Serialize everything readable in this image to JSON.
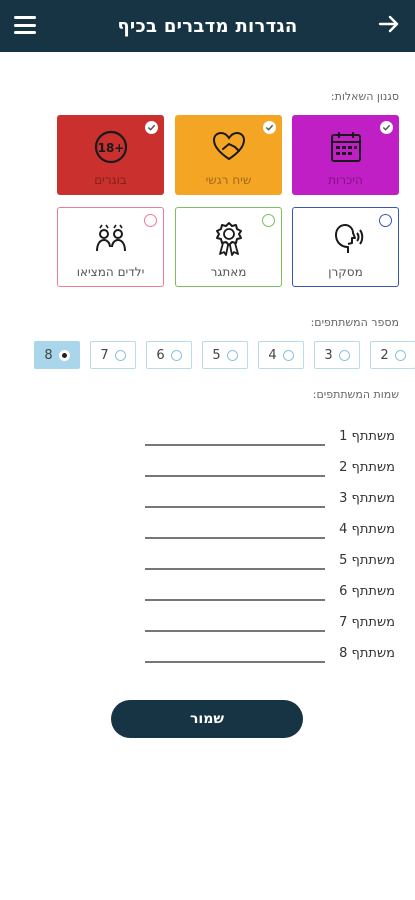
{
  "header": {
    "title": "הגדרות מדברים בכיף"
  },
  "styles_section": {
    "label": "סגנון השאלות:",
    "cards": [
      {
        "label": "היכרות",
        "selected": true,
        "color": "#c11fc6",
        "icon": "calendar-icon"
      },
      {
        "label": "שיח רגשי",
        "selected": true,
        "color": "#f5a524",
        "icon": "heart-hand-icon"
      },
      {
        "label": "בוגרים",
        "selected": true,
        "color": "#c9302e",
        "icon": "age-18-icon"
      },
      {
        "label": "מסקרן",
        "selected": false,
        "color": "#3a56b8",
        "icon": "listening-head-icon"
      },
      {
        "label": "מאתגר",
        "selected": false,
        "color": "#7dbf5c",
        "icon": "award-ribbon-icon"
      },
      {
        "label": "ילדים המציאו",
        "selected": false,
        "color": "#ee7c92",
        "icon": "kids-group-icon"
      }
    ]
  },
  "count_section": {
    "label": "מספר המשתתפים:",
    "options": [
      "2",
      "3",
      "4",
      "5",
      "6",
      "7",
      "8"
    ],
    "selected": "8"
  },
  "names_section": {
    "label": "שמות המשתתפים:",
    "participants": [
      {
        "label": "משתתף 1",
        "value": ""
      },
      {
        "label": "משתתף 2",
        "value": ""
      },
      {
        "label": "משתתף 3",
        "value": ""
      },
      {
        "label": "משתתף 4",
        "value": ""
      },
      {
        "label": "משתתף 5",
        "value": ""
      },
      {
        "label": "משתתף 6",
        "value": ""
      },
      {
        "label": "משתתף 7",
        "value": ""
      },
      {
        "label": "משתתף 8",
        "value": ""
      }
    ]
  },
  "save_label": "שמור"
}
